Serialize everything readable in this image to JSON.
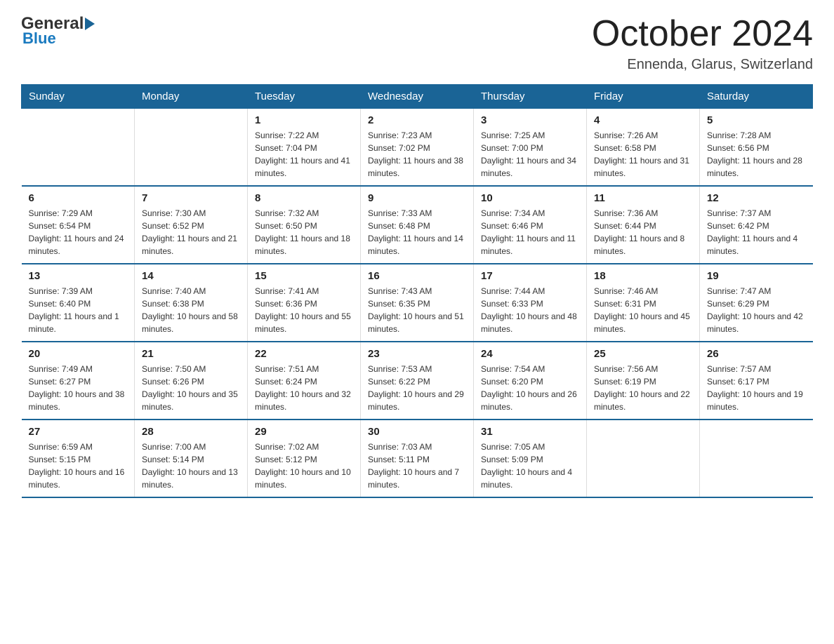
{
  "header": {
    "month": "October 2024",
    "location": "Ennenda, Glarus, Switzerland",
    "logo_general": "General",
    "logo_blue": "Blue"
  },
  "days_of_week": [
    "Sunday",
    "Monday",
    "Tuesday",
    "Wednesday",
    "Thursday",
    "Friday",
    "Saturday"
  ],
  "weeks": [
    [
      {
        "day": "",
        "sunrise": "",
        "sunset": "",
        "daylight": ""
      },
      {
        "day": "",
        "sunrise": "",
        "sunset": "",
        "daylight": ""
      },
      {
        "day": "1",
        "sunrise": "Sunrise: 7:22 AM",
        "sunset": "Sunset: 7:04 PM",
        "daylight": "Daylight: 11 hours and 41 minutes."
      },
      {
        "day": "2",
        "sunrise": "Sunrise: 7:23 AM",
        "sunset": "Sunset: 7:02 PM",
        "daylight": "Daylight: 11 hours and 38 minutes."
      },
      {
        "day": "3",
        "sunrise": "Sunrise: 7:25 AM",
        "sunset": "Sunset: 7:00 PM",
        "daylight": "Daylight: 11 hours and 34 minutes."
      },
      {
        "day": "4",
        "sunrise": "Sunrise: 7:26 AM",
        "sunset": "Sunset: 6:58 PM",
        "daylight": "Daylight: 11 hours and 31 minutes."
      },
      {
        "day": "5",
        "sunrise": "Sunrise: 7:28 AM",
        "sunset": "Sunset: 6:56 PM",
        "daylight": "Daylight: 11 hours and 28 minutes."
      }
    ],
    [
      {
        "day": "6",
        "sunrise": "Sunrise: 7:29 AM",
        "sunset": "Sunset: 6:54 PM",
        "daylight": "Daylight: 11 hours and 24 minutes."
      },
      {
        "day": "7",
        "sunrise": "Sunrise: 7:30 AM",
        "sunset": "Sunset: 6:52 PM",
        "daylight": "Daylight: 11 hours and 21 minutes."
      },
      {
        "day": "8",
        "sunrise": "Sunrise: 7:32 AM",
        "sunset": "Sunset: 6:50 PM",
        "daylight": "Daylight: 11 hours and 18 minutes."
      },
      {
        "day": "9",
        "sunrise": "Sunrise: 7:33 AM",
        "sunset": "Sunset: 6:48 PM",
        "daylight": "Daylight: 11 hours and 14 minutes."
      },
      {
        "day": "10",
        "sunrise": "Sunrise: 7:34 AM",
        "sunset": "Sunset: 6:46 PM",
        "daylight": "Daylight: 11 hours and 11 minutes."
      },
      {
        "day": "11",
        "sunrise": "Sunrise: 7:36 AM",
        "sunset": "Sunset: 6:44 PM",
        "daylight": "Daylight: 11 hours and 8 minutes."
      },
      {
        "day": "12",
        "sunrise": "Sunrise: 7:37 AM",
        "sunset": "Sunset: 6:42 PM",
        "daylight": "Daylight: 11 hours and 4 minutes."
      }
    ],
    [
      {
        "day": "13",
        "sunrise": "Sunrise: 7:39 AM",
        "sunset": "Sunset: 6:40 PM",
        "daylight": "Daylight: 11 hours and 1 minute."
      },
      {
        "day": "14",
        "sunrise": "Sunrise: 7:40 AM",
        "sunset": "Sunset: 6:38 PM",
        "daylight": "Daylight: 10 hours and 58 minutes."
      },
      {
        "day": "15",
        "sunrise": "Sunrise: 7:41 AM",
        "sunset": "Sunset: 6:36 PM",
        "daylight": "Daylight: 10 hours and 55 minutes."
      },
      {
        "day": "16",
        "sunrise": "Sunrise: 7:43 AM",
        "sunset": "Sunset: 6:35 PM",
        "daylight": "Daylight: 10 hours and 51 minutes."
      },
      {
        "day": "17",
        "sunrise": "Sunrise: 7:44 AM",
        "sunset": "Sunset: 6:33 PM",
        "daylight": "Daylight: 10 hours and 48 minutes."
      },
      {
        "day": "18",
        "sunrise": "Sunrise: 7:46 AM",
        "sunset": "Sunset: 6:31 PM",
        "daylight": "Daylight: 10 hours and 45 minutes."
      },
      {
        "day": "19",
        "sunrise": "Sunrise: 7:47 AM",
        "sunset": "Sunset: 6:29 PM",
        "daylight": "Daylight: 10 hours and 42 minutes."
      }
    ],
    [
      {
        "day": "20",
        "sunrise": "Sunrise: 7:49 AM",
        "sunset": "Sunset: 6:27 PM",
        "daylight": "Daylight: 10 hours and 38 minutes."
      },
      {
        "day": "21",
        "sunrise": "Sunrise: 7:50 AM",
        "sunset": "Sunset: 6:26 PM",
        "daylight": "Daylight: 10 hours and 35 minutes."
      },
      {
        "day": "22",
        "sunrise": "Sunrise: 7:51 AM",
        "sunset": "Sunset: 6:24 PM",
        "daylight": "Daylight: 10 hours and 32 minutes."
      },
      {
        "day": "23",
        "sunrise": "Sunrise: 7:53 AM",
        "sunset": "Sunset: 6:22 PM",
        "daylight": "Daylight: 10 hours and 29 minutes."
      },
      {
        "day": "24",
        "sunrise": "Sunrise: 7:54 AM",
        "sunset": "Sunset: 6:20 PM",
        "daylight": "Daylight: 10 hours and 26 minutes."
      },
      {
        "day": "25",
        "sunrise": "Sunrise: 7:56 AM",
        "sunset": "Sunset: 6:19 PM",
        "daylight": "Daylight: 10 hours and 22 minutes."
      },
      {
        "day": "26",
        "sunrise": "Sunrise: 7:57 AM",
        "sunset": "Sunset: 6:17 PM",
        "daylight": "Daylight: 10 hours and 19 minutes."
      }
    ],
    [
      {
        "day": "27",
        "sunrise": "Sunrise: 6:59 AM",
        "sunset": "Sunset: 5:15 PM",
        "daylight": "Daylight: 10 hours and 16 minutes."
      },
      {
        "day": "28",
        "sunrise": "Sunrise: 7:00 AM",
        "sunset": "Sunset: 5:14 PM",
        "daylight": "Daylight: 10 hours and 13 minutes."
      },
      {
        "day": "29",
        "sunrise": "Sunrise: 7:02 AM",
        "sunset": "Sunset: 5:12 PM",
        "daylight": "Daylight: 10 hours and 10 minutes."
      },
      {
        "day": "30",
        "sunrise": "Sunrise: 7:03 AM",
        "sunset": "Sunset: 5:11 PM",
        "daylight": "Daylight: 10 hours and 7 minutes."
      },
      {
        "day": "31",
        "sunrise": "Sunrise: 7:05 AM",
        "sunset": "Sunset: 5:09 PM",
        "daylight": "Daylight: 10 hours and 4 minutes."
      },
      {
        "day": "",
        "sunrise": "",
        "sunset": "",
        "daylight": ""
      },
      {
        "day": "",
        "sunrise": "",
        "sunset": "",
        "daylight": ""
      }
    ]
  ]
}
